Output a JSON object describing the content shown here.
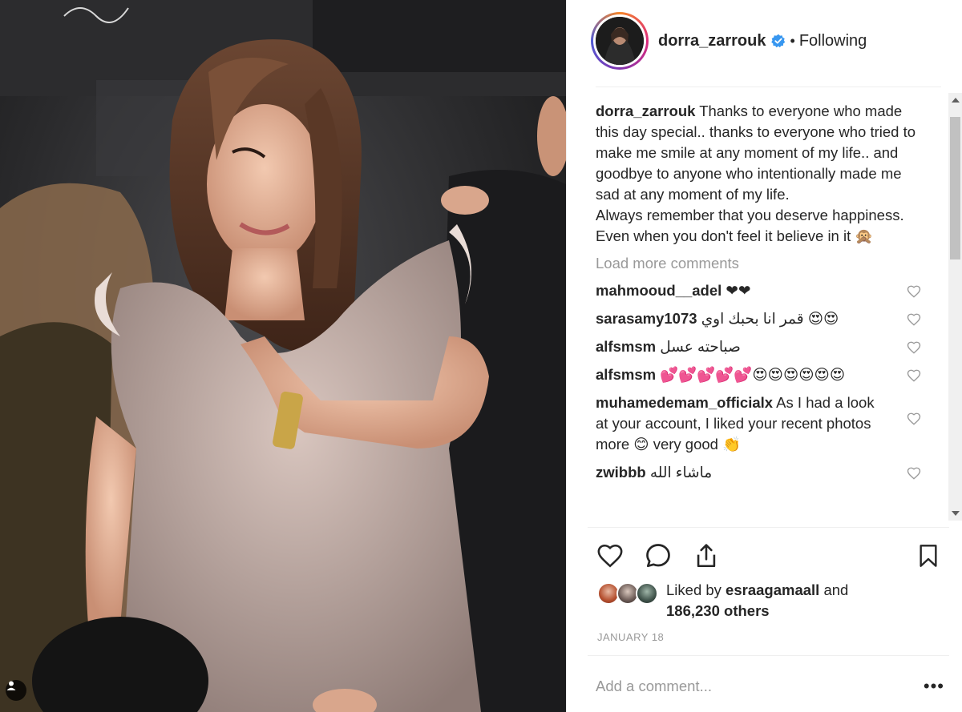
{
  "post": {
    "author": "dorra_zarrouk",
    "follow_status": "Following",
    "dot": "•",
    "caption_user": "dorra_zarrouk",
    "caption_text": " Thanks to everyone who made this day special.. thanks to everyone who tried to make me smile at any moment of my life.. and goodbye to anyone who intentionally made me sad at any moment of my life.\nAlways remember that you deserve happiness. Even when you don't feel it believe in it 🙊",
    "load_more": "Load more comments",
    "comments": [
      {
        "user": "mahmooud__adel",
        "text": " ❤❤"
      },
      {
        "user": "sarasamy1073",
        "text": " قمر انا بحبك اوي 😍😍"
      },
      {
        "user": "alfsmsm",
        "text": " صباحته عسل"
      },
      {
        "user": "alfsmsm",
        "text": " 💕💕💕💕💕😍😍😍😍😍😍"
      },
      {
        "user": "muhamedemam_officialx",
        "text": " As I had a look at your account, I liked your recent photos more 😊 very good 👏"
      },
      {
        "user": "zwibbb",
        "text": " ماشاء الله"
      }
    ],
    "liked_by_prefix": "Liked by ",
    "liked_by_user": "esraagamaall",
    "liked_by_suffix": " and",
    "likes_count": "186,230 others",
    "date": "January 18",
    "add_comment_placeholder": "Add a comment...",
    "more_options": "•••"
  },
  "icons": {
    "verified": "verified-badge-icon",
    "like": "heart-icon",
    "comment": "comment-icon",
    "share": "share-icon",
    "save": "bookmark-icon",
    "user_tag": "user-tag-icon"
  },
  "colors": {
    "text": "#262626",
    "muted": "#999999",
    "verified": "#3897f0",
    "divider": "#efefef"
  }
}
